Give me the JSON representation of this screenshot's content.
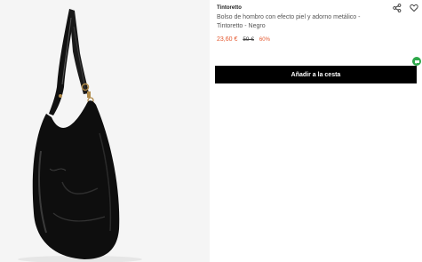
{
  "product": {
    "brand": "Tintoretto",
    "title": "Bolso de hombro con efecto piel y adorno metálico - Tintoretto - Negro",
    "price_current": "23,60 €",
    "price_original": "59 €",
    "discount": "60%",
    "image_alt": "Bolso de hombro negro Tintoretto"
  },
  "actions": {
    "add_to_cart": "Añadir a la cesta",
    "share_icon": "share-icon",
    "favorite_icon": "heart-icon"
  },
  "colors": {
    "accent_price": "#e4572e",
    "button_bg": "#000000",
    "chat_green": "#2ea84a"
  }
}
